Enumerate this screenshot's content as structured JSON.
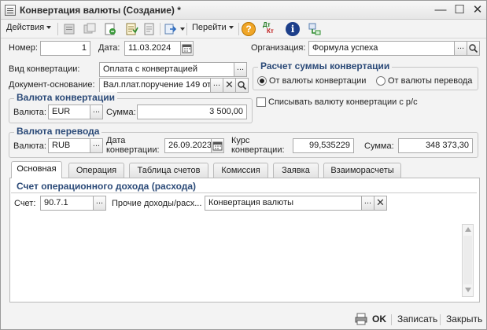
{
  "window": {
    "title": "Конвертация валюты (Создание) *",
    "controls": {
      "minimize": "—",
      "maximize": "☐",
      "close": "✕"
    }
  },
  "toolbar": {
    "actions_label": "Действия",
    "goto_label": "Перейти",
    "help_label": "?",
    "dtkt_top": "Дт",
    "dtkt_bottom": "Кт",
    "info_label": "i"
  },
  "header": {
    "number_label": "Номер:",
    "number_value": "1",
    "date_label": "Дата:",
    "date_value": "11.03.2024",
    "org_label": "Организация:",
    "org_value": "Формула успеха"
  },
  "conversion": {
    "type_label": "Вид конвертации:",
    "type_value": "Оплата с конвертацией",
    "basis_label": "Документ-основание:",
    "basis_value": "Вал.плат.поручение 149 от"
  },
  "calc": {
    "title": "Расчет суммы конвертации",
    "option_from": "От валюты конвертации",
    "option_to": "От валюты перевода",
    "selected": "option_from",
    "writeoff_label": "Списывать валюту конвертации с р/с"
  },
  "conv_currency": {
    "title": "Валюта конвертации",
    "currency_label": "Валюта:",
    "currency_value": "EUR",
    "sum_label": "Сумма:",
    "sum_value": "3 500,00"
  },
  "transfer_currency": {
    "title": "Валюта перевода",
    "currency_label": "Валюта:",
    "currency_value": "RUB",
    "date_label_1": "Дата",
    "date_label_2": "конвертации:",
    "date_value": "26.09.2023",
    "rate_label_1": "Курс",
    "rate_label_2": "конвертации:",
    "rate_value": "99,535229",
    "sum_label": "Сумма:",
    "sum_value": "348 373,30"
  },
  "tabs": [
    {
      "label": "Основная"
    },
    {
      "label": "Операция"
    },
    {
      "label": "Таблица счетов"
    },
    {
      "label": "Комиссия"
    },
    {
      "label": "Заявка"
    },
    {
      "label": "Взаиморасчеты"
    }
  ],
  "main_tab": {
    "section_title": "Счет операционного дохода (расхода)",
    "account_label": "Счет:",
    "account_value": "90.7.1",
    "subconto_label": "Прочие доходы/расх...",
    "subconto_value": "Конвертация валюты"
  },
  "footer": {
    "ok_label": "OK",
    "save_label": "Записать",
    "close_label": "Закрыть"
  },
  "colors": {
    "section_title": "#2b4a78",
    "window_bg": "#f3f3f3"
  }
}
